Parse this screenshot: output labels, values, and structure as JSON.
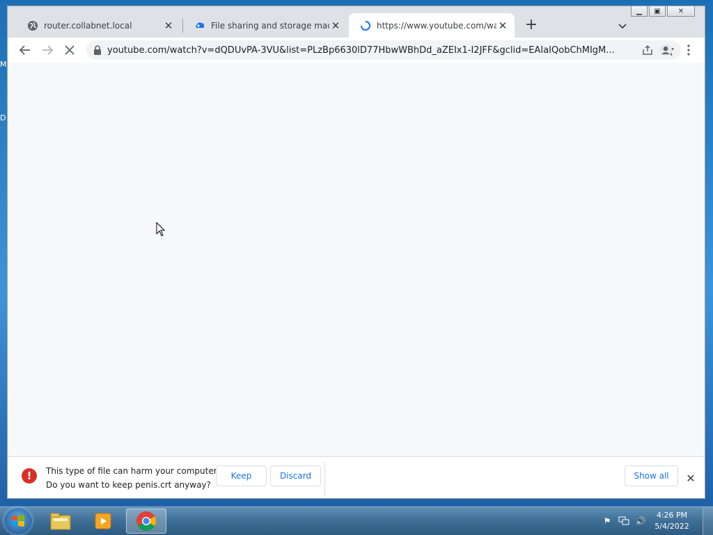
{
  "desktop": {
    "edge_letters": [
      "M",
      "D"
    ]
  },
  "browser": {
    "tabs": [
      {
        "label": "router.collabnet.local",
        "icon": "globe-icon",
        "active": false
      },
      {
        "label": "File sharing and storage made si",
        "icon": "cloud-icon",
        "active": false
      },
      {
        "label": "https://www.youtube.com/watch",
        "icon": "loading-spinner-icon",
        "active": true
      }
    ],
    "new_tab_label": "+",
    "address": {
      "url": "youtube.com/watch?v=dQDUvPA-3VU&list=PLzBp6630lD77HbwWBhDd_aZEIx1-I2JFF&gclid=EAIaIQobChMIgM..."
    },
    "colors": {
      "accent": "#1a73e8",
      "warning": "#d93025",
      "content_bg": "#f8f9fa"
    }
  },
  "download_shelf": {
    "warning_line1": "This type of file can harm your computer.",
    "warning_line2": "Do you want to keep penis.crt anyway?",
    "keep_label": "Keep",
    "discard_label": "Discard",
    "show_all_label": "Show all"
  },
  "taskbar": {
    "apps": [
      "file-explorer-icon",
      "media-player-icon",
      "chrome-icon"
    ],
    "clock_time": "4:26 PM",
    "clock_date": "5/4/2022"
  }
}
